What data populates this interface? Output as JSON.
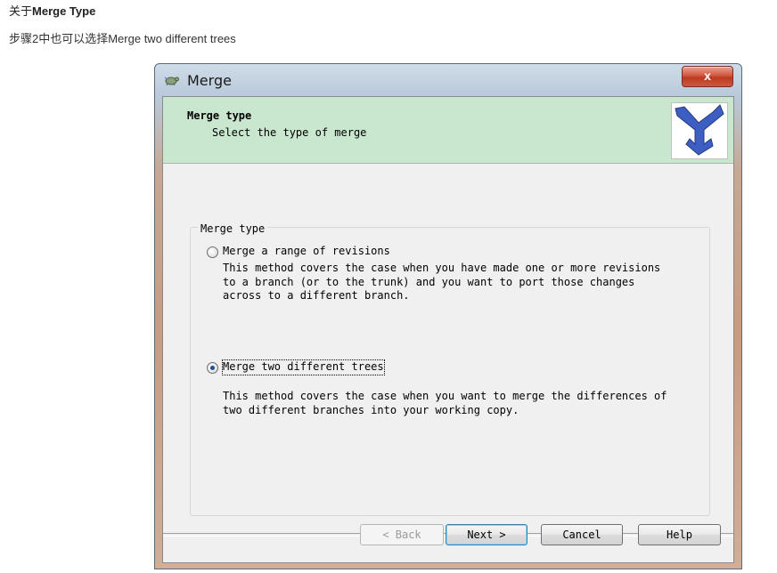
{
  "article": {
    "heading_prefix": "关于",
    "heading_bold": "Merge Type",
    "text": "步骤2中也可以选择Merge two different trees"
  },
  "window": {
    "title": "Merge",
    "close_label": "x",
    "header_title": "Merge type",
    "header_subtitle": "Select the type of merge",
    "group_label": "Merge type",
    "options": [
      {
        "label": "Merge a range of revisions",
        "description": "This method covers the case when you have made one or more revisions\nto a branch (or to the trunk) and you want to port those changes\nacross to a different branch.",
        "checked": false
      },
      {
        "label": "Merge two different trees",
        "description": "This method covers the case when you want to merge the differences of\ntwo different branches into your working copy.",
        "checked": true
      }
    ],
    "buttons": {
      "back": "< Back",
      "next": "Next >",
      "cancel": "Cancel",
      "help": "Help"
    }
  },
  "colors": {
    "header_band": "#c9e6cf",
    "logo_blue": "#3d5fc4",
    "close_red": "#c9482e"
  },
  "icons": {
    "title_icon": "tortoise-icon",
    "logo": "merge-arrow-icon"
  }
}
